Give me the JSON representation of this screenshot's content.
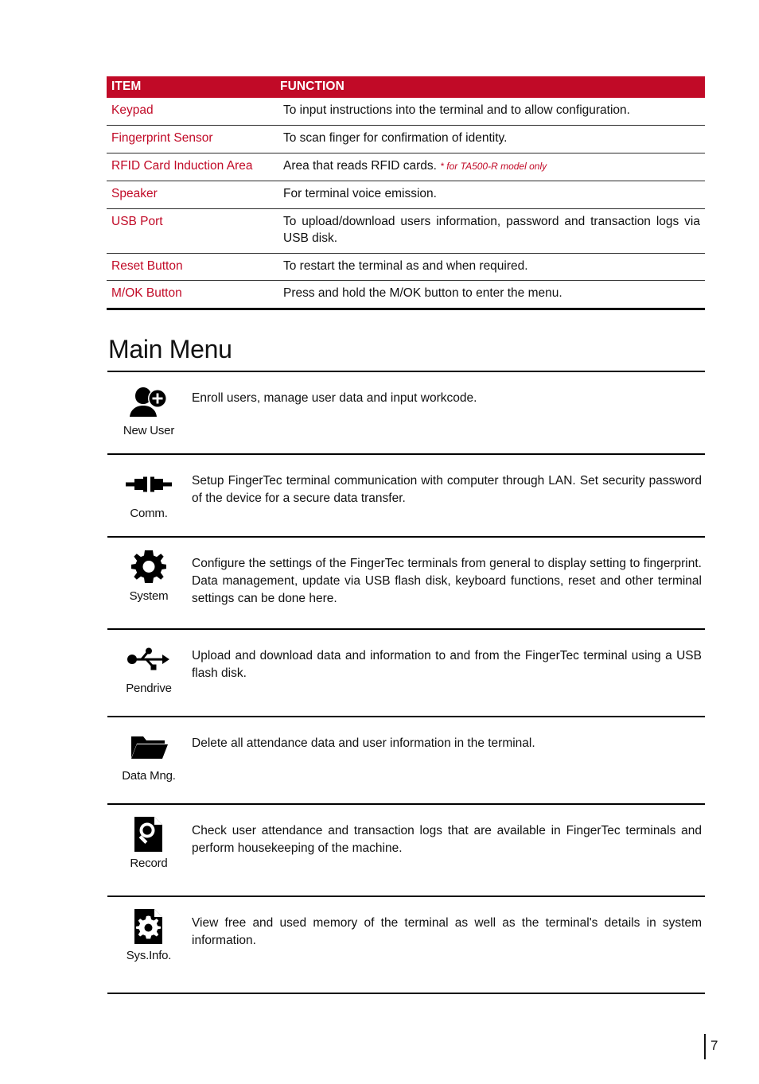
{
  "table": {
    "headers": {
      "item": "ITEM",
      "function": "FUNCTION"
    },
    "header_bg": "#C10A27",
    "item_color": "#C10A27",
    "rows": [
      {
        "item": "Keypad",
        "function": "To input instructions into the terminal and to allow configuration.",
        "note": ""
      },
      {
        "item": "Fingerprint Sensor",
        "function": "To scan finger for confirmation of identity.",
        "note": ""
      },
      {
        "item": "RFID Card Induction Area",
        "function": "Area that reads RFID cards.",
        "note": "* for TA500-R model only"
      },
      {
        "item": "Speaker",
        "function": "For terminal voice emission.",
        "note": ""
      },
      {
        "item": "USB Port",
        "function": "To upload/download users information, password and transaction logs via USB disk.",
        "note": ""
      },
      {
        "item": "Reset Button",
        "function": "To restart the terminal as and when required.",
        "note": ""
      },
      {
        "item": "M/OK Button",
        "function": "Press and hold the M/OK button to enter the menu.",
        "note": ""
      }
    ]
  },
  "main_menu": {
    "title": "Main Menu",
    "items": [
      {
        "icon": "new-user-icon",
        "label": "New User",
        "description": "Enroll users, manage user data and input workcode."
      },
      {
        "icon": "comm-plug-icon",
        "label": "Comm.",
        "description": "Setup FingerTec terminal communication with computer through LAN. Set security password of the device for a secure data transfer."
      },
      {
        "icon": "gear-icon",
        "label": "System",
        "description": "Configure the settings of the FingerTec terminals from general to display setting to fingerprint. Data management, update via USB flash disk, keyboard functions, reset and other terminal settings can be done here."
      },
      {
        "icon": "usb-icon",
        "label": "Pendrive",
        "description": "Upload and download data and information to and from the FingerTec terminal using a USB flash disk."
      },
      {
        "icon": "folder-icon",
        "label": "Data Mng.",
        "description": "Delete all attendance data and user information in the terminal."
      },
      {
        "icon": "document-search-icon",
        "label": "Record",
        "description": "Check user attendance and transaction logs that are available in FingerTec terminals and perform housekeeping of the machine."
      },
      {
        "icon": "document-gear-icon",
        "label": "Sys.Info.",
        "description": "View free and used memory of the terminal as well as the terminal's details in system information."
      }
    ]
  },
  "footer": {
    "page_number": "7"
  }
}
